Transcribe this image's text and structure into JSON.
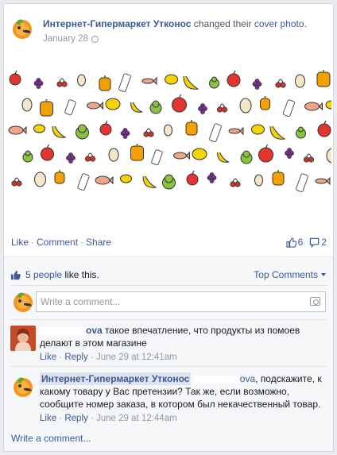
{
  "post": {
    "page_name": "Интернет-Гипермаркет Утконос",
    "action_text": "changed their",
    "action_link": "cover photo",
    "period": ".",
    "date": "January 28"
  },
  "actions": {
    "like": "Like",
    "comment": "Comment",
    "share": "Share",
    "separator": "·",
    "like_count": "6",
    "comment_count": "2"
  },
  "feedback": {
    "likes_link": "5 people",
    "likes_suffix": "like this.",
    "top_comments": "Top Comments",
    "write_placeholder": "Write a comment...",
    "bottom_write": "Write a comment..."
  },
  "comments": [
    {
      "author_partial": "ova",
      "text": "такое впечатление, что продукты из помоев делают в этом магазине",
      "like": "Like",
      "reply": "Reply",
      "time": "June 29 at 12:41am",
      "sep": "·"
    },
    {
      "author": "Интернет-Гипермаркет Утконос",
      "mention_partial": "ova",
      "text": ", подскажите, к какому товару у Вас претензии? Так же, если возможно, сообщите номер заказа, в котором был некачественный товар.",
      "like": "Like",
      "reply": "Reply",
      "time": "June 29 at 12:44am",
      "sep": "·"
    }
  ],
  "colors": {
    "link": "#3b5998",
    "muted": "#9197a3",
    "feedback_bg": "#f6f7f9",
    "brand_orange": "#f7941d",
    "brand_green": "#5fa82f"
  },
  "icons": [
    "globe-icon",
    "thumbs-up-icon",
    "speech-bubble-icon",
    "camera-icon",
    "chevron-down-icon"
  ]
}
